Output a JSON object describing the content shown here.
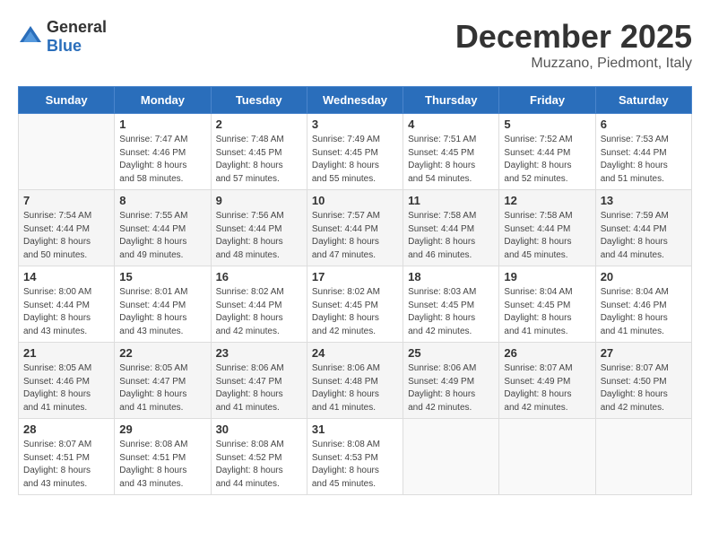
{
  "logo": {
    "text_general": "General",
    "text_blue": "Blue"
  },
  "header": {
    "month": "December 2025",
    "location": "Muzzano, Piedmont, Italy"
  },
  "days_of_week": [
    "Sunday",
    "Monday",
    "Tuesday",
    "Wednesday",
    "Thursday",
    "Friday",
    "Saturday"
  ],
  "weeks": [
    [
      {
        "day": "",
        "info": ""
      },
      {
        "day": "1",
        "info": "Sunrise: 7:47 AM\nSunset: 4:46 PM\nDaylight: 8 hours\nand 58 minutes."
      },
      {
        "day": "2",
        "info": "Sunrise: 7:48 AM\nSunset: 4:45 PM\nDaylight: 8 hours\nand 57 minutes."
      },
      {
        "day": "3",
        "info": "Sunrise: 7:49 AM\nSunset: 4:45 PM\nDaylight: 8 hours\nand 55 minutes."
      },
      {
        "day": "4",
        "info": "Sunrise: 7:51 AM\nSunset: 4:45 PM\nDaylight: 8 hours\nand 54 minutes."
      },
      {
        "day": "5",
        "info": "Sunrise: 7:52 AM\nSunset: 4:44 PM\nDaylight: 8 hours\nand 52 minutes."
      },
      {
        "day": "6",
        "info": "Sunrise: 7:53 AM\nSunset: 4:44 PM\nDaylight: 8 hours\nand 51 minutes."
      }
    ],
    [
      {
        "day": "7",
        "info": "Sunrise: 7:54 AM\nSunset: 4:44 PM\nDaylight: 8 hours\nand 50 minutes."
      },
      {
        "day": "8",
        "info": "Sunrise: 7:55 AM\nSunset: 4:44 PM\nDaylight: 8 hours\nand 49 minutes."
      },
      {
        "day": "9",
        "info": "Sunrise: 7:56 AM\nSunset: 4:44 PM\nDaylight: 8 hours\nand 48 minutes."
      },
      {
        "day": "10",
        "info": "Sunrise: 7:57 AM\nSunset: 4:44 PM\nDaylight: 8 hours\nand 47 minutes."
      },
      {
        "day": "11",
        "info": "Sunrise: 7:58 AM\nSunset: 4:44 PM\nDaylight: 8 hours\nand 46 minutes."
      },
      {
        "day": "12",
        "info": "Sunrise: 7:58 AM\nSunset: 4:44 PM\nDaylight: 8 hours\nand 45 minutes."
      },
      {
        "day": "13",
        "info": "Sunrise: 7:59 AM\nSunset: 4:44 PM\nDaylight: 8 hours\nand 44 minutes."
      }
    ],
    [
      {
        "day": "14",
        "info": "Sunrise: 8:00 AM\nSunset: 4:44 PM\nDaylight: 8 hours\nand 43 minutes."
      },
      {
        "day": "15",
        "info": "Sunrise: 8:01 AM\nSunset: 4:44 PM\nDaylight: 8 hours\nand 43 minutes."
      },
      {
        "day": "16",
        "info": "Sunrise: 8:02 AM\nSunset: 4:44 PM\nDaylight: 8 hours\nand 42 minutes."
      },
      {
        "day": "17",
        "info": "Sunrise: 8:02 AM\nSunset: 4:45 PM\nDaylight: 8 hours\nand 42 minutes."
      },
      {
        "day": "18",
        "info": "Sunrise: 8:03 AM\nSunset: 4:45 PM\nDaylight: 8 hours\nand 42 minutes."
      },
      {
        "day": "19",
        "info": "Sunrise: 8:04 AM\nSunset: 4:45 PM\nDaylight: 8 hours\nand 41 minutes."
      },
      {
        "day": "20",
        "info": "Sunrise: 8:04 AM\nSunset: 4:46 PM\nDaylight: 8 hours\nand 41 minutes."
      }
    ],
    [
      {
        "day": "21",
        "info": "Sunrise: 8:05 AM\nSunset: 4:46 PM\nDaylight: 8 hours\nand 41 minutes."
      },
      {
        "day": "22",
        "info": "Sunrise: 8:05 AM\nSunset: 4:47 PM\nDaylight: 8 hours\nand 41 minutes."
      },
      {
        "day": "23",
        "info": "Sunrise: 8:06 AM\nSunset: 4:47 PM\nDaylight: 8 hours\nand 41 minutes."
      },
      {
        "day": "24",
        "info": "Sunrise: 8:06 AM\nSunset: 4:48 PM\nDaylight: 8 hours\nand 41 minutes."
      },
      {
        "day": "25",
        "info": "Sunrise: 8:06 AM\nSunset: 4:49 PM\nDaylight: 8 hours\nand 42 minutes."
      },
      {
        "day": "26",
        "info": "Sunrise: 8:07 AM\nSunset: 4:49 PM\nDaylight: 8 hours\nand 42 minutes."
      },
      {
        "day": "27",
        "info": "Sunrise: 8:07 AM\nSunset: 4:50 PM\nDaylight: 8 hours\nand 42 minutes."
      }
    ],
    [
      {
        "day": "28",
        "info": "Sunrise: 8:07 AM\nSunset: 4:51 PM\nDaylight: 8 hours\nand 43 minutes."
      },
      {
        "day": "29",
        "info": "Sunrise: 8:08 AM\nSunset: 4:51 PM\nDaylight: 8 hours\nand 43 minutes."
      },
      {
        "day": "30",
        "info": "Sunrise: 8:08 AM\nSunset: 4:52 PM\nDaylight: 8 hours\nand 44 minutes."
      },
      {
        "day": "31",
        "info": "Sunrise: 8:08 AM\nSunset: 4:53 PM\nDaylight: 8 hours\nand 45 minutes."
      },
      {
        "day": "",
        "info": ""
      },
      {
        "day": "",
        "info": ""
      },
      {
        "day": "",
        "info": ""
      }
    ]
  ]
}
